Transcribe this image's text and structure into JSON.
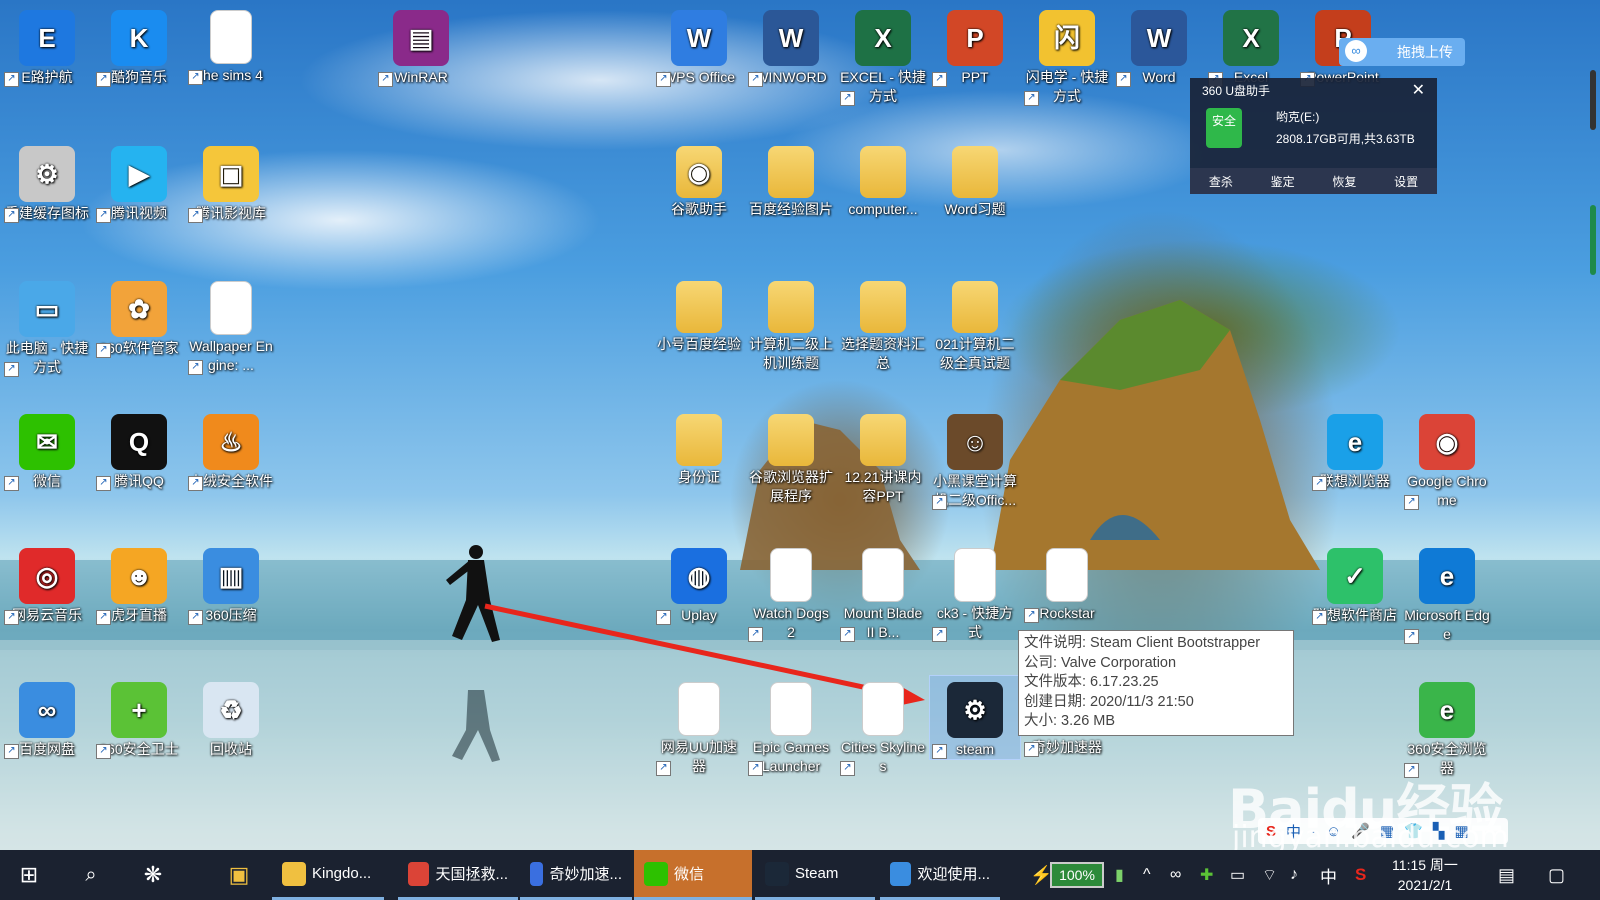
{
  "desktop": {
    "icons": [
      {
        "label": "E路护航",
        "glyph": "E",
        "color": "#1e78e0"
      },
      {
        "label": "酷狗音乐",
        "glyph": "K",
        "color": "#1a8cf0"
      },
      {
        "label": "the sims 4",
        "glyph": "",
        "color": "#ffffff"
      },
      {
        "label": "WinRAR",
        "glyph": "▤",
        "color": "#8a2a8a"
      },
      {
        "label": "WPS Office",
        "glyph": "W",
        "color": "#2f7de1"
      },
      {
        "label": "WINWORD",
        "glyph": "W",
        "color": "#2b5797"
      },
      {
        "label": "EXCEL - 快捷方式",
        "glyph": "X",
        "color": "#1e7145"
      },
      {
        "label": "PPT",
        "glyph": "P",
        "color": "#d24726"
      },
      {
        "label": "闪电学 - 快捷方式",
        "glyph": "闪",
        "color": "#f2c230"
      },
      {
        "label": "Word",
        "glyph": "W",
        "color": "#2b579a"
      },
      {
        "label": "Excel",
        "glyph": "X",
        "color": "#217346"
      },
      {
        "label": "PowerPoint",
        "glyph": "P",
        "color": "#c43e1c"
      },
      {
        "label": "重建缓存图标",
        "glyph": "⚙",
        "color": "#c8c8c8"
      },
      {
        "label": "腾讯视频",
        "glyph": "▶",
        "color": "#25b3f0"
      },
      {
        "label": "腾讯影视库",
        "glyph": "▣",
        "color": "#f5c63a"
      },
      {
        "label": "谷歌助手",
        "glyph": "◉",
        "color": "#e9b73a"
      },
      {
        "label": "百度经验图片",
        "glyph": "",
        "color": "#e9b73a"
      },
      {
        "label": "computer...",
        "glyph": "",
        "color": "#e9b73a"
      },
      {
        "label": "Word习题",
        "glyph": "",
        "color": "#e9b73a"
      },
      {
        "label": "此电脑 - 快捷方式",
        "glyph": "▭",
        "color": "#4aa8e8"
      },
      {
        "label": "360软件管家",
        "glyph": "✿",
        "color": "#f2a33a"
      },
      {
        "label": "Wallpaper Engine: ...",
        "glyph": "",
        "color": "#ffffff"
      },
      {
        "label": "小号百度经验",
        "glyph": "",
        "color": "#e9b73a"
      },
      {
        "label": "计算机二级上机训练题",
        "glyph": "",
        "color": "#e9b73a"
      },
      {
        "label": "选择题资料汇总",
        "glyph": "",
        "color": "#e9b73a"
      },
      {
        "label": "021计算机二级全真试题",
        "glyph": "",
        "color": "#e9b73a"
      },
      {
        "label": "微信",
        "glyph": "✉",
        "color": "#2dc100"
      },
      {
        "label": "腾讯QQ",
        "glyph": "Q",
        "color": "#111111"
      },
      {
        "label": "火绒安全软件",
        "glyph": "♨",
        "color": "#f08a1c"
      },
      {
        "label": "身份证",
        "glyph": "",
        "color": "#e9b73a"
      },
      {
        "label": "谷歌浏览器扩展程序",
        "glyph": "",
        "color": "#e9b73a"
      },
      {
        "label": "12.21讲课内容PPT",
        "glyph": "",
        "color": "#e9b73a"
      },
      {
        "label": "小黑课堂计算机二级Offic...",
        "glyph": "☺",
        "color": "#6b4a2a"
      },
      {
        "label": "联想浏览器",
        "glyph": "e",
        "color": "#1aa0e8"
      },
      {
        "label": "Google Chrome",
        "glyph": "◉",
        "color": "#db4437"
      },
      {
        "label": "网易云音乐",
        "glyph": "◎",
        "color": "#e02a2a"
      },
      {
        "label": "虎牙直播",
        "glyph": "☻",
        "color": "#f5a623"
      },
      {
        "label": "360压缩",
        "glyph": "▥",
        "color": "#3a8de0"
      },
      {
        "label": "Uplay",
        "glyph": "◍",
        "color": "#1a6fe0"
      },
      {
        "label": "Watch Dogs 2",
        "glyph": "",
        "color": "#ffffff"
      },
      {
        "label": "Mount Blade II B...",
        "glyph": "",
        "color": "#ffffff"
      },
      {
        "label": "ck3 - 快捷方式",
        "glyph": "",
        "color": "#ffffff"
      },
      {
        "label": "Rockstar",
        "glyph": "",
        "color": "#ffffff"
      },
      {
        "label": "联想软件商店",
        "glyph": "✓",
        "color": "#2dc16a"
      },
      {
        "label": "Microsoft Edge",
        "glyph": "e",
        "color": "#0f7ad6"
      },
      {
        "label": "百度网盘",
        "glyph": "∞",
        "color": "#3a8de0"
      },
      {
        "label": "360安全卫士",
        "glyph": "+",
        "color": "#5bc236"
      },
      {
        "label": "回收站",
        "glyph": "♻",
        "color": "#d9e6f2"
      },
      {
        "label": "网易UU加速器",
        "glyph": "",
        "color": "#ffffff"
      },
      {
        "label": "Epic Games Launcher",
        "glyph": "",
        "color": "#ffffff"
      },
      {
        "label": "Cities Skylines",
        "glyph": "",
        "color": "#ffffff"
      },
      {
        "label": "steam",
        "glyph": "⚙",
        "color": "#1b2838"
      },
      {
        "label": "奇妙加速器",
        "glyph": "",
        "color": "#ffffff"
      },
      {
        "label": "360安全浏览器",
        "glyph": "e",
        "color": "#3ab54a"
      }
    ]
  },
  "tooltip": {
    "description": "文件说明: Steam Client Bootstrapper",
    "company": "公司: Valve Corporation",
    "version": "文件版本: 6.17.23.25",
    "created": "创建日期: 2020/11/3 21:50",
    "size": "大小: 3.26 MB"
  },
  "usb_panel": {
    "title": "360 U盘助手",
    "badge": "安全",
    "drive": "哟克(E:)",
    "space": "2808.17GB可用,共3.63TB",
    "actions": [
      "查杀",
      "鉴定",
      "恢复",
      "设置"
    ],
    "close": "✕"
  },
  "upload_button": {
    "label": "拖拽上传"
  },
  "taskbar": {
    "apps": [
      {
        "label": "Kingdo...",
        "color": "#f0c040"
      },
      {
        "label": "天国拯救...",
        "color": "#db4437"
      },
      {
        "label": "奇妙加速...",
        "color": "#3a6fe0"
      },
      {
        "label": "微信",
        "color": "#2dc100"
      },
      {
        "label": "Steam",
        "color": "#1b2838"
      },
      {
        "label": "欢迎使用...",
        "color": "#3a8de0"
      }
    ],
    "battery": "100%",
    "ime": "中",
    "time": "11:15 周一",
    "date": "2021/2/1"
  },
  "watermark": {
    "text": "Baidu经验",
    "sub": "jingyan.baidu.com"
  },
  "sogou_bar": {
    "items": [
      "S",
      "中",
      "·",
      "☺",
      "🎤",
      "▦",
      "👕",
      "▚",
      "▦"
    ]
  }
}
